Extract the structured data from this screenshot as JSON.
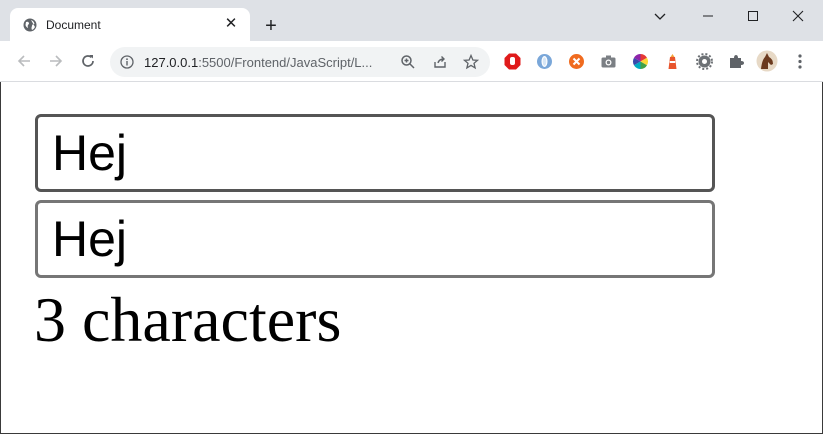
{
  "browser": {
    "tab": {
      "title": "Document",
      "favicon": "globe-icon",
      "close_icon": "close-icon"
    },
    "new_tab_icon": "plus-icon",
    "window_controls": [
      "chevron-down-icon",
      "minimize-icon",
      "maximize-icon",
      "close-icon"
    ],
    "nav": {
      "back": "back-arrow-icon",
      "forward": "forward-arrow-icon",
      "reload": "reload-icon"
    },
    "address": {
      "host": "127.0.0.1",
      "rest": ":5500/Frontend/JavaScript/L..."
    },
    "omnibox_icons": [
      "zoom-icon",
      "share-icon",
      "bookmark-star-icon"
    ],
    "extensions": [
      "adblock-icon",
      "opera-like-icon",
      "orange-extension-icon",
      "camera-icon",
      "color-wheel-icon",
      "lighthouse-icon",
      "gear-extension-icon",
      "puzzle-icon",
      "profile-avatar"
    ]
  },
  "page": {
    "input_top_value": "Hej",
    "input_bottom_value": "Hej",
    "char_count_text": "3 characters"
  },
  "colors": {
    "tabstrip": "#dee1e6",
    "input_border_top": "#555555",
    "input_border_bottom": "#767676"
  }
}
